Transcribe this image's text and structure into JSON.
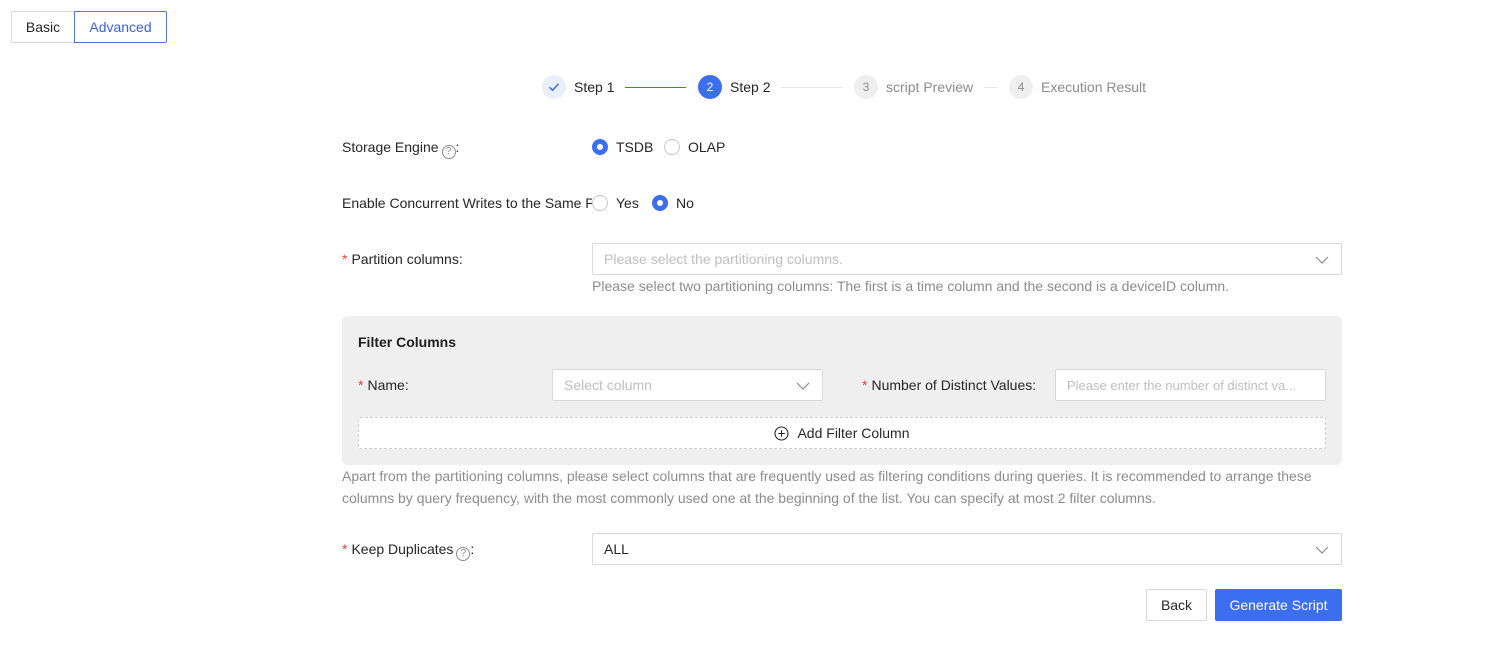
{
  "mode_tabs": {
    "basic": "Basic",
    "advanced": "Advanced"
  },
  "steps": [
    {
      "number": "1",
      "label": "Step 1",
      "status": "done"
    },
    {
      "number": "2",
      "label": "Step 2",
      "status": "active"
    },
    {
      "number": "3",
      "label": "script Preview",
      "status": "wait"
    },
    {
      "number": "4",
      "label": "Execution Result",
      "status": "wait"
    }
  ],
  "storage_engine": {
    "label": "Storage Engine",
    "colon": ":",
    "options": [
      "TSDB",
      "OLAP"
    ],
    "selected": "TSDB"
  },
  "concurrent_writes": {
    "label": "Enable Concurrent Writes to the Same Pa",
    "options": [
      "Yes",
      "No"
    ],
    "selected": "No"
  },
  "partition_columns": {
    "required_mark": "*",
    "label": "Partition columns",
    "colon": ":",
    "placeholder": "Please select the partitioning columns.",
    "hint": "Please select two partitioning columns: The first is a time column and the second is a deviceID column."
  },
  "filter_columns": {
    "title": "Filter Columns",
    "name_label": "Name",
    "name_colon": ":",
    "name_placeholder": "Select column",
    "distinct_label": "Number of Distinct Values",
    "distinct_colon": ":",
    "distinct_placeholder": "Please enter the number of distinct va...",
    "add_button": "Add Filter Column",
    "hint_line1": "Apart from the partitioning columns, please select columns that are frequently used as filtering conditions during queries. It is recommended to arrange these",
    "hint_line2": "columns by query frequency, with the most commonly used one at the beginning of the list. You can specify at most 2 filter columns."
  },
  "keep_duplicates": {
    "label": "Keep Duplicates",
    "colon": ":",
    "value": "ALL"
  },
  "buttons": {
    "back": "Back",
    "generate": "Generate Script"
  },
  "colors": {
    "primary": "#3b6ef0",
    "required": "#e54545",
    "panel_bg": "#efefef"
  }
}
